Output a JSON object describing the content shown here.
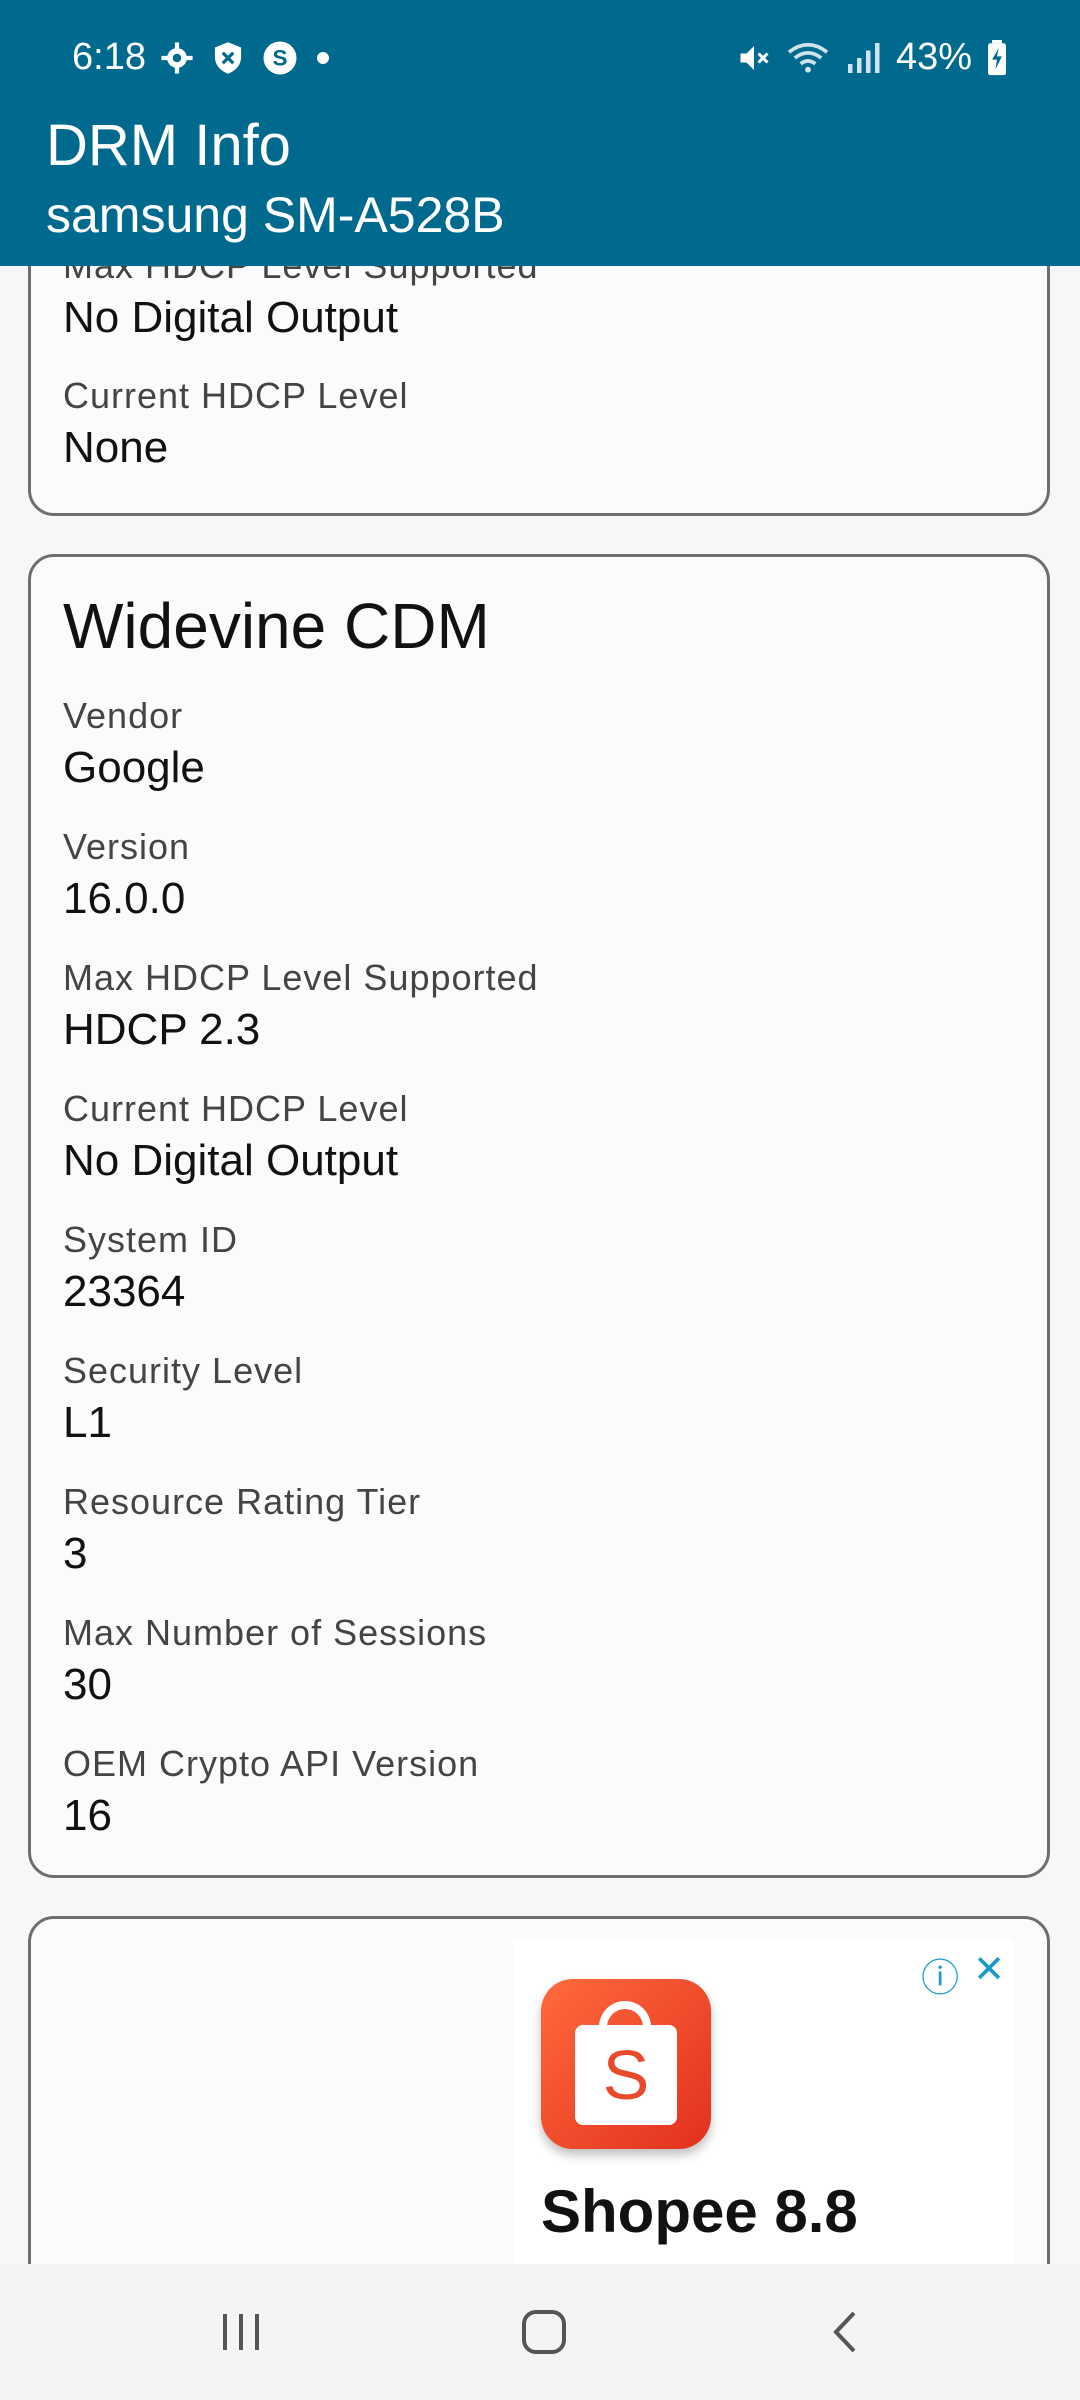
{
  "status_bar": {
    "time": "6:18",
    "battery": "43%",
    "icons": [
      "gear-icon",
      "shield-icon",
      "skype-icon",
      "dot-icon",
      "mute-icon",
      "wifi-icon",
      "signal-icon",
      "battery-icon"
    ]
  },
  "app_bar": {
    "title": "DRM Info",
    "subtitle": "samsung SM-A528B",
    "color": "#006a8e"
  },
  "card_top": {
    "fields": [
      {
        "label": "Max HDCP Level Supported",
        "value": "No Digital Output"
      },
      {
        "label": "Current HDCP Level",
        "value": "None"
      }
    ]
  },
  "widevine": {
    "title": "Widevine CDM",
    "fields": [
      {
        "label": "Vendor",
        "value": "Google"
      },
      {
        "label": "Version",
        "value": "16.0.0"
      },
      {
        "label": "Max HDCP Level Supported",
        "value": "HDCP 2.3"
      },
      {
        "label": "Current HDCP Level",
        "value": "No Digital Output"
      },
      {
        "label": "System ID",
        "value": "23364"
      },
      {
        "label": "Security Level",
        "value": "L1"
      },
      {
        "label": "Resource Rating Tier",
        "value": "3"
      },
      {
        "label": "Max Number of Sessions",
        "value": "30"
      },
      {
        "label": "OEM Crypto API Version",
        "value": "16"
      }
    ]
  },
  "ad": {
    "headline": "Shopee 8.8",
    "logo_letter": "S",
    "info_icon": "ⓘ",
    "close_icon": "✕"
  },
  "navbar": {
    "recent_icon": "|||",
    "back_icon": "‹"
  }
}
